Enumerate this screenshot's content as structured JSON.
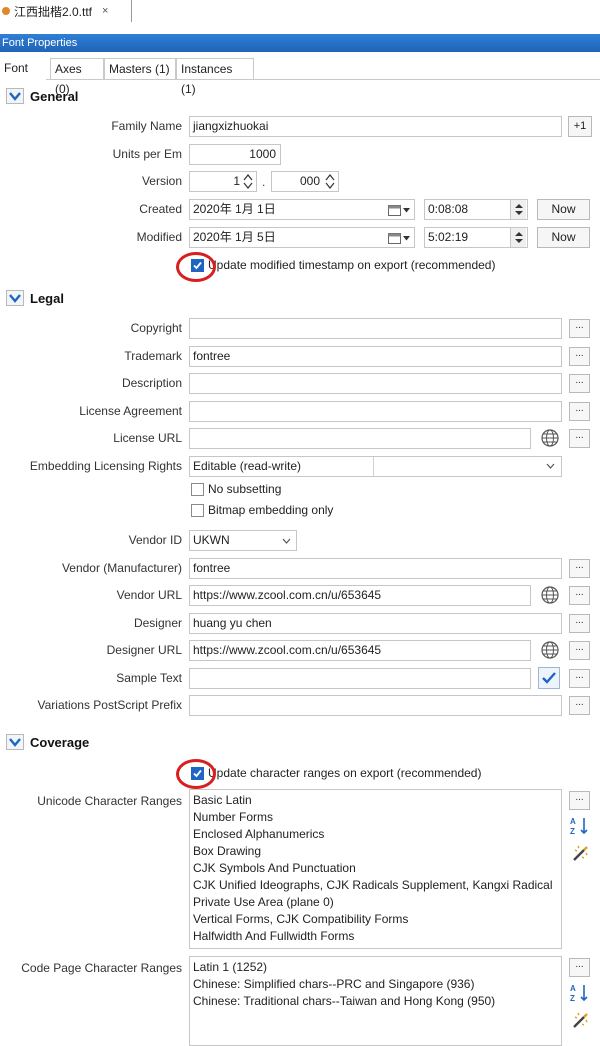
{
  "document_tab": {
    "title": "江西拙楷2.0.ttf",
    "close": "×"
  },
  "panel": {
    "title": "Font Properties"
  },
  "subtabs": [
    {
      "label": "Font"
    },
    {
      "label": "Axes (0)"
    },
    {
      "label": "Masters (1)"
    },
    {
      "label": "Instances (1)"
    }
  ],
  "general": {
    "header": "General",
    "family_name_label": "Family Name",
    "family_name": "jiangxizhuokai",
    "family_plus": "+1",
    "units_label": "Units per Em",
    "units": "1000",
    "version_label": "Version",
    "version_major": "1",
    "version_dot": ".",
    "version_minor": "000",
    "created_label": "Created",
    "created_date": "2020年  1月  1日",
    "created_time": "0:08:08",
    "modified_label": "Modified",
    "modified_date": "2020年  1月  5日",
    "modified_time": "5:02:19",
    "now_label": "Now",
    "update_modified_label": "Update modified timestamp on export (recommended)"
  },
  "legal": {
    "header": "Legal",
    "copyright_label": "Copyright",
    "copyright": "",
    "trademark_label": "Trademark",
    "trademark": "fontree",
    "description_label": "Description",
    "description": "",
    "license_label": "License Agreement",
    "license": "",
    "license_url_label": "License URL",
    "license_url": "",
    "embedding_label": "Embedding Licensing Rights",
    "embedding_value": "Editable (read-write)",
    "no_subsetting_label": "No subsetting",
    "bitmap_only_label": "Bitmap embedding only",
    "vendor_id_label": "Vendor ID",
    "vendor_id": "UKWN",
    "vendor_label": "Vendor (Manufacturer)",
    "vendor": "fontree",
    "vendor_url_label": "Vendor URL",
    "vendor_url": "https://www.zcool.com.cn/u/653645",
    "designer_label": "Designer",
    "designer": "huang yu chen",
    "designer_url_label": "Designer URL",
    "designer_url": "https://www.zcool.com.cn/u/653645",
    "sample_text_label": "Sample Text",
    "sample_text": "",
    "variations_label": "Variations PostScript Prefix",
    "variations": "",
    "dots": "..."
  },
  "coverage": {
    "header": "Coverage",
    "update_ranges_label": "Update character ranges on export (recommended)",
    "unicode_label": "Unicode Character Ranges",
    "unicode_ranges": [
      "Basic Latin",
      "Number Forms",
      "Enclosed Alphanumerics",
      "Box Drawing",
      "CJK Symbols And Punctuation",
      "CJK Unified Ideographs, CJK Radicals Supplement, Kangxi Radical",
      "Private Use Area (plane 0)",
      "Vertical Forms, CJK Compatibility Forms",
      "Halfwidth And Fullwidth Forms"
    ],
    "codepage_label": "Code Page Character Ranges",
    "codepage_ranges": [
      "Latin 1 (1252)",
      "Chinese: Simplified chars--PRC and Singapore (936)",
      "Chinese: Traditional chars--Taiwan and Hong Kong (950)"
    ]
  },
  "colors": {
    "accent": "#1f66c2",
    "highlight_circle": "#d81e1e",
    "titlebar": "#2a74cc"
  }
}
